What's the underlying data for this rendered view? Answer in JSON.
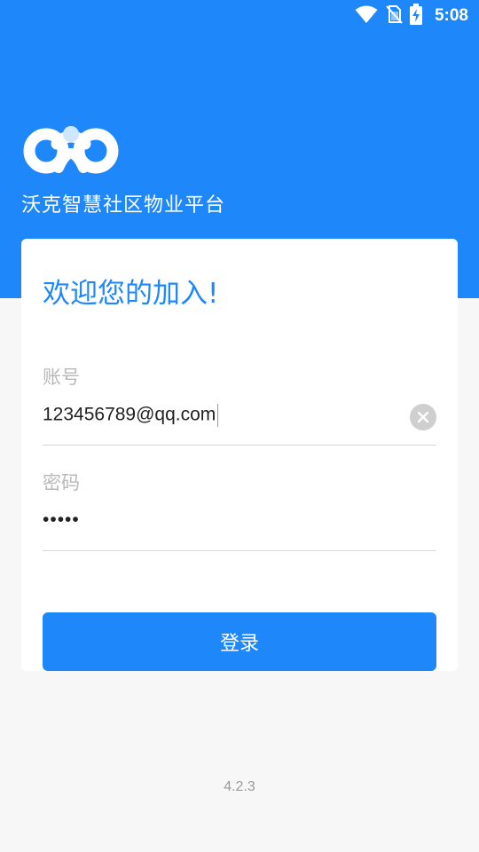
{
  "status_bar": {
    "time": "5:08",
    "icons": [
      "wifi-icon",
      "no-sim-icon",
      "battery-charging-icon"
    ]
  },
  "header": {
    "logo_icon": "cloud-pin-logo",
    "app_title": "沃克智慧社区物业平台"
  },
  "login_form": {
    "welcome": "欢迎您的加入!",
    "account": {
      "label": "账号",
      "value": "123456789@qq.com",
      "clear_icon": "clear-circle-icon"
    },
    "password": {
      "label": "密码",
      "value": "•••••"
    },
    "submit_label": "登录"
  },
  "footer": {
    "version": "4.2.3"
  },
  "colors": {
    "brand_blue": "#1e88fa",
    "background": "#f7f7f7",
    "card": "#ffffff",
    "placeholder": "#b8b8b8"
  }
}
